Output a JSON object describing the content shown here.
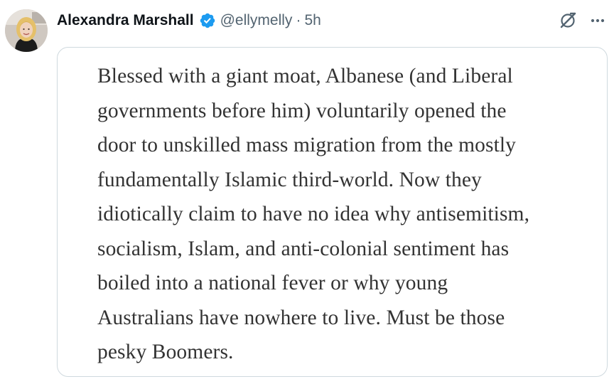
{
  "author": {
    "display_name": "Alexandra Marshall",
    "handle": "@ellymelly",
    "separator": "·",
    "time": "5h",
    "verified": true
  },
  "icons": {
    "verified": "verified-badge-icon",
    "grok": "grok-icon",
    "more": "more-horizontal-icon"
  },
  "colors": {
    "verified_blue": "#1d9bf0",
    "name_text": "#0f1419",
    "secondary_text": "#536471",
    "card_border": "#cfd9de",
    "quote_text": "#333333"
  },
  "quote": {
    "lines": [
      "Blessed with a giant moat, Albanese (and Liberal",
      "governments before him) voluntarily opened the",
      "door to unskilled mass migration from the mostly",
      "fundamentally Islamic third-world. Now they",
      "idiotically claim to have no idea why antisemitism,",
      "socialism, Islam, and anti-colonial sentiment has",
      "boiled into a national fever or why young",
      "Australians have nowhere to live. Must be those",
      "pesky Boomers."
    ]
  }
}
